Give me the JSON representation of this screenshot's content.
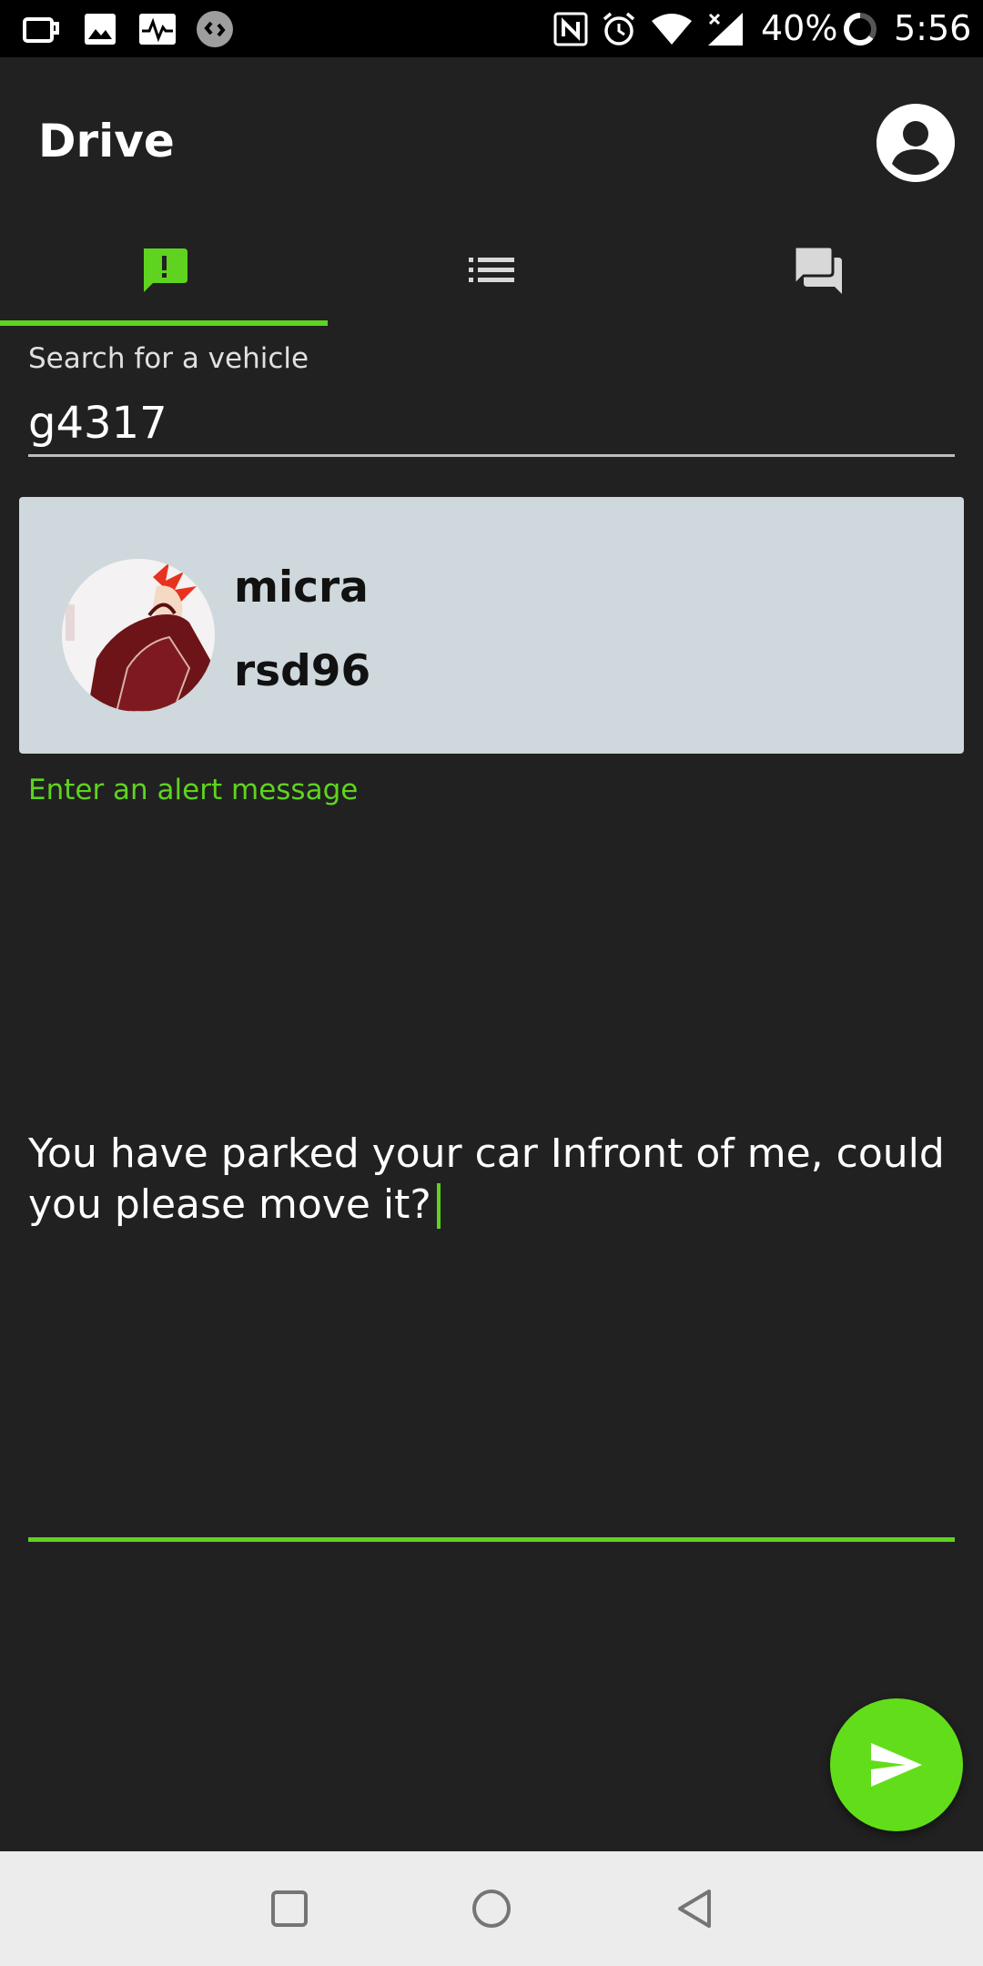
{
  "status_bar": {
    "battery_percent": "40%",
    "time": "5:56",
    "left_icons": [
      "cup-icon",
      "image-icon",
      "pulse-icon",
      "shazam-icon"
    ],
    "right_icons": [
      "nfc-icon",
      "alarm-icon",
      "wifi-icon",
      "signal-icon",
      "battery-icon"
    ]
  },
  "app_bar": {
    "title": "Drive",
    "account_icon": "account-circle-icon"
  },
  "tabs": [
    {
      "icon": "alert-message-icon",
      "selected": true
    },
    {
      "icon": "list-icon",
      "selected": false
    },
    {
      "icon": "chat-icon",
      "selected": false
    }
  ],
  "search": {
    "label": "Search for a vehicle",
    "value": "g4317"
  },
  "vehicle_result": {
    "name": "micra",
    "plate": "rsd96"
  },
  "alert": {
    "label": "Enter an alert message",
    "value": "You have parked your car Infront of me, could you please move it?"
  },
  "fab": {
    "icon": "send-icon"
  },
  "nav_bar": {
    "icons": [
      "recents-icon",
      "home-icon",
      "back-icon"
    ]
  },
  "colors": {
    "background": "#212121",
    "accent": "#5fd31f",
    "card": "#cfd8dc",
    "status_bar": "#000000",
    "nav_bar": "#ececec"
  }
}
